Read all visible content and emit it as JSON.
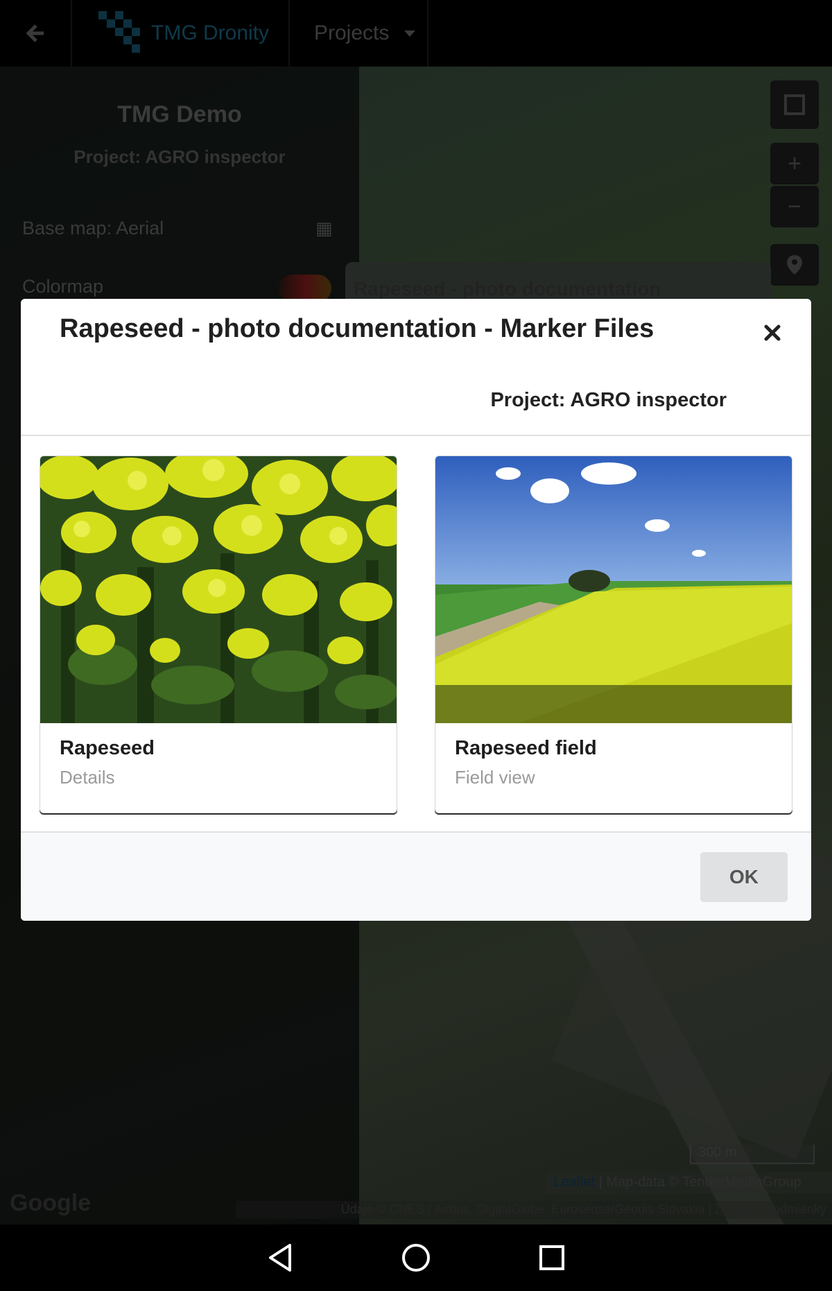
{
  "topbar": {
    "brand": "TMG Dronity",
    "projects_label": "Projects"
  },
  "sidepanel": {
    "title": "TMG Demo",
    "subtitle": "Project: AGRO inspector",
    "basemap_label": "Base map: Aerial",
    "colormap_label": "Colormap"
  },
  "map": {
    "popup_title": "Rapeseed - photo documentation",
    "scale_label": "300 m",
    "attribution_link": "Leaflet",
    "attribution_text": " | Map-data © TenderMediaGroup",
    "imagery_attribution": "Údaje © CNES / Airbus, DigitalGlobe, Eurosense/Geodis Slovakia  |  Zmluvné podmienky",
    "google_label": "Google"
  },
  "modal": {
    "title": "Rapeseed - photo documentation - Marker Files",
    "project": "Project: AGRO inspector",
    "cards": [
      {
        "name": "Rapeseed",
        "description": "Details"
      },
      {
        "name": "Rapeseed field",
        "description": "Field view"
      }
    ],
    "ok_label": "OK"
  },
  "colors": {
    "brand": "#0f3a4a",
    "modal_bg": "#ffffff",
    "footer_bg": "#f8f9fa",
    "ok_button_bg": "#e0e1e2",
    "flower_yellow": "#d9e21c",
    "sky_blue": "#3d6fc9"
  },
  "icons": {
    "back": "arrow-left-icon",
    "close": "close-icon",
    "nav_back": "triangle-back-icon",
    "nav_home": "circle-home-icon",
    "nav_recents": "square-recents-icon"
  }
}
